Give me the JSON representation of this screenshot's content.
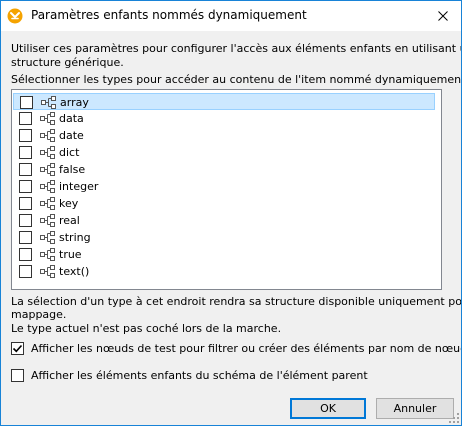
{
  "dialog": {
    "title": "Paramètres enfants nommés dynamiquement",
    "close_label": "✕"
  },
  "intro": {
    "line1": "Utiliser ces paramètres pour configurer l'accès aux éléments enfants en utilisant une",
    "line2": "structure générique."
  },
  "list_caption": "Sélectionner les types pour accéder au contenu de l'item nommé dynamiquement :",
  "types": [
    {
      "label": "array",
      "checked": false,
      "selected": true
    },
    {
      "label": "data",
      "checked": false,
      "selected": false
    },
    {
      "label": "date",
      "checked": false,
      "selected": false
    },
    {
      "label": "dict",
      "checked": false,
      "selected": false
    },
    {
      "label": "false",
      "checked": false,
      "selected": false
    },
    {
      "label": "integer",
      "checked": false,
      "selected": false
    },
    {
      "label": "key",
      "checked": false,
      "selected": false
    },
    {
      "label": "real",
      "checked": false,
      "selected": false
    },
    {
      "label": "string",
      "checked": false,
      "selected": false
    },
    {
      "label": "true",
      "checked": false,
      "selected": false
    },
    {
      "label": "text()",
      "checked": false,
      "selected": false
    }
  ],
  "note": {
    "line1": "La sélection d'un type à cet endroit rendra sa structure disponible uniquement pour le",
    "line2": "mappage.",
    "line3": "Le type actuel n'est pas coché lors de la marche."
  },
  "options": {
    "show_test_nodes": {
      "label": "Afficher les nœuds de test pour filtrer ou créer des éléments par nom de nœud fixé",
      "checked": true
    },
    "show_schema_children": {
      "label": "Afficher les éléments enfants du schéma de l'élément parent",
      "checked": false
    }
  },
  "buttons": {
    "ok": "OK",
    "cancel": "Annuler"
  },
  "colors": {
    "accent": "#0078d7",
    "selection": "#cce8ff",
    "app_icon": "#f5a300"
  },
  "icons": {
    "app": "mapforce-app-icon",
    "node": "node-tree-icon",
    "check": "check-icon",
    "close": "close-icon"
  }
}
